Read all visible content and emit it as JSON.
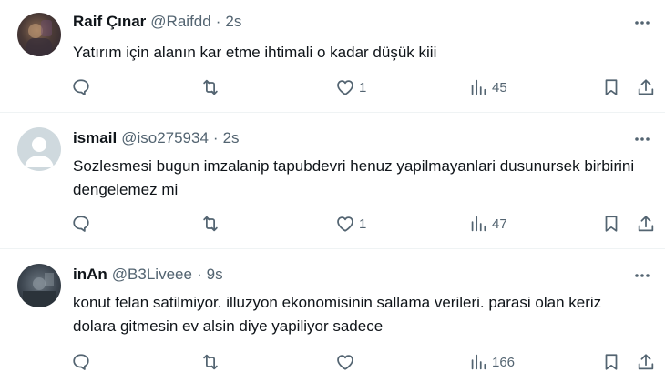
{
  "tweets": [
    {
      "name": "Raif Çınar",
      "handle": "@Raifdd",
      "dot": "·",
      "time": "2s",
      "text": "Yatırım için alanın kar etme ihtimali o kadar düşük kiii",
      "replies": "",
      "retweets": "",
      "likes": "1",
      "views": "45"
    },
    {
      "name": "ismail",
      "handle": "@iso275934",
      "dot": "·",
      "time": "2s",
      "text": "Sozlesmesi bugun imzalanip tapubdevri henuz yapilmayanlari dusunursek birbirini dengelemez mi",
      "replies": "",
      "retweets": "",
      "likes": "1",
      "views": "47"
    },
    {
      "name": "inAn",
      "handle": "@B3Liveee",
      "dot": "·",
      "time": "9s",
      "text": "konut felan satilmiyor. illuzyon ekonomisinin sallama verileri. parasi olan keriz dolara gitmesin ev alsin diye yapiliyor sadece",
      "replies": "",
      "retweets": "",
      "likes": "",
      "views": "166"
    }
  ],
  "icons": {
    "more": "more-horizontal-icon",
    "reply": "reply-bubble-icon",
    "retweet": "retweet-icon",
    "like": "heart-icon",
    "views": "bar-chart-icon",
    "bookmark": "bookmark-icon",
    "share": "share-upload-icon"
  },
  "colors": {
    "text": "#0f1419",
    "secondary": "#536471",
    "divider": "#eff3f4"
  }
}
